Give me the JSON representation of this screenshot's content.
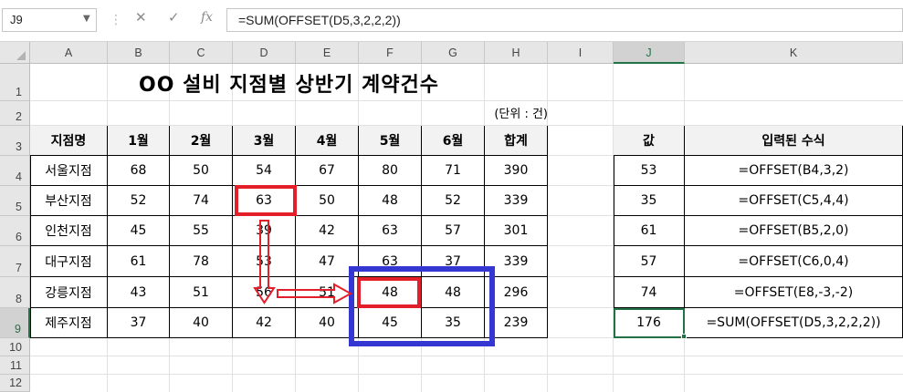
{
  "name_box": "J9",
  "formula": "=SUM(OFFSET(D5,3,2,2,2))",
  "toolbar": {
    "cancel": "✕",
    "enter": "✓",
    "function": "fx"
  },
  "columns": [
    "A",
    "B",
    "C",
    "D",
    "E",
    "F",
    "G",
    "H",
    "I",
    "J",
    "K"
  ],
  "rows": [
    "1",
    "2",
    "3",
    "4",
    "5",
    "6",
    "7",
    "8",
    "9",
    "10",
    "11",
    "12"
  ],
  "sheet": {
    "title": "OO 설비 지점별 상반기 계약건수",
    "unit": "(단위 : 건)",
    "headers": [
      "지점명",
      "1월",
      "2월",
      "3월",
      "4월",
      "5월",
      "6월",
      "합계"
    ],
    "data": [
      [
        "서울지점",
        "68",
        "50",
        "54",
        "67",
        "80",
        "71",
        "390"
      ],
      [
        "부산지점",
        "52",
        "74",
        "63",
        "50",
        "48",
        "52",
        "339"
      ],
      [
        "인천지점",
        "45",
        "55",
        "39",
        "42",
        "63",
        "57",
        "301"
      ],
      [
        "대구지점",
        "61",
        "78",
        "53",
        "47",
        "63",
        "37",
        "339"
      ],
      [
        "강릉지점",
        "43",
        "51",
        "56",
        "51",
        "48",
        "48",
        "296"
      ],
      [
        "제주지점",
        "37",
        "40",
        "42",
        "40",
        "45",
        "35",
        "239"
      ]
    ],
    "right_headers": [
      "값",
      "입력된 수식"
    ],
    "right_data": [
      [
        "53",
        "=OFFSET(B4,3,2)"
      ],
      [
        "35",
        "=OFFSET(C5,4,4)"
      ],
      [
        "61",
        "=OFFSET(B5,2,0)"
      ],
      [
        "57",
        "=OFFSET(C6,0,4)"
      ],
      [
        "74",
        "=OFFSET(E8,-3,-2)"
      ],
      [
        "176",
        "=SUM(OFFSET(D5,3,2,2,2))"
      ]
    ]
  },
  "colors": {
    "accent": "#217346",
    "red_box": "#e3202a",
    "blue_box": "#3437d1",
    "header_fill": "#f2f2f2"
  }
}
